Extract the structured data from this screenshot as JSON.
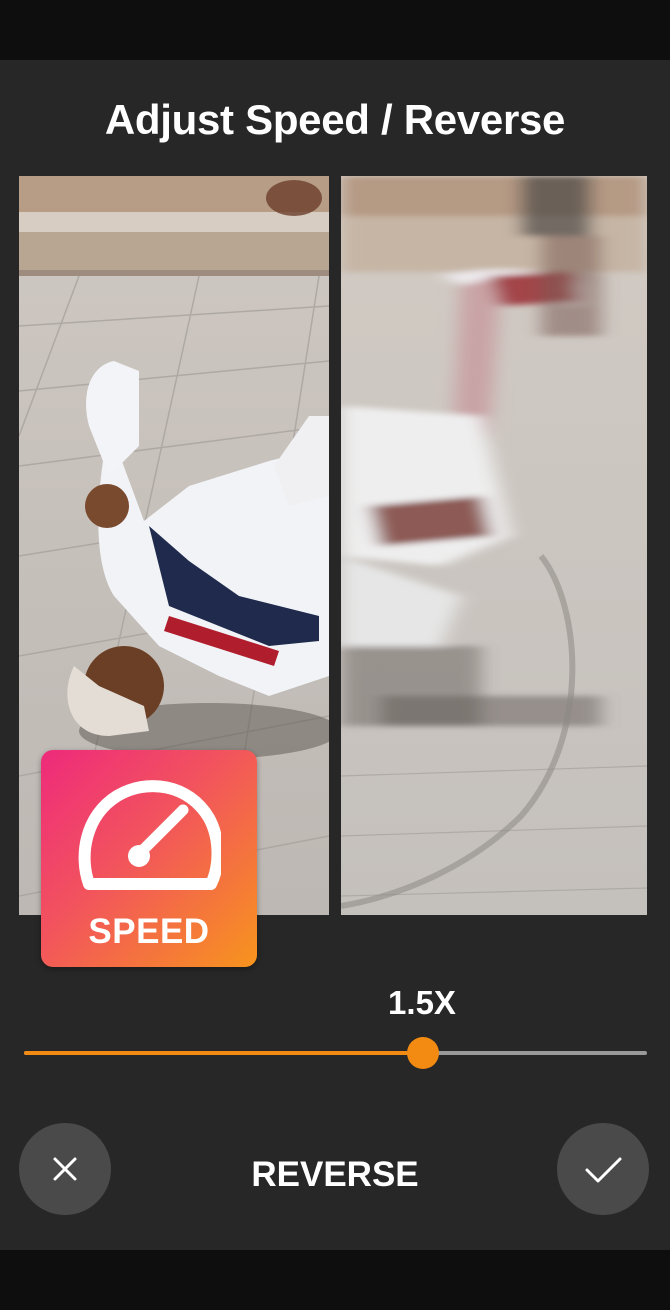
{
  "screen": {
    "title": "Adjust Speed / Reverse"
  },
  "preview": {
    "left_image": "breakdancer-photo-sharp",
    "right_image": "breakdancer-photo-motion-blur"
  },
  "badge": {
    "icon": "speedometer-icon",
    "label": "SPEED"
  },
  "speed_slider": {
    "value_label": "1.5X",
    "fraction": 0.64
  },
  "actions": {
    "cancel_icon": "close-icon",
    "reverse_label": "REVERSE",
    "confirm_icon": "checkmark-icon"
  },
  "colors": {
    "accent": "#f38a12",
    "panel": "#272727",
    "badge_gradient_start": "#ee2a7b",
    "badge_gradient_end": "#f7941d"
  }
}
